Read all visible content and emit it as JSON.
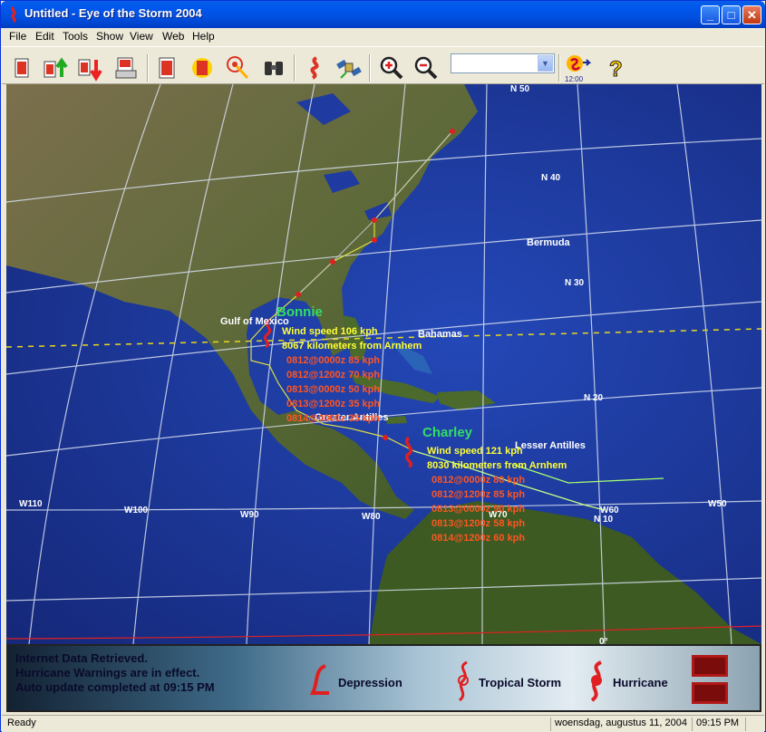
{
  "window": {
    "title": "Untitled - Eye of the Storm 2004",
    "controls": [
      "_",
      "□",
      "✕"
    ]
  },
  "menu": [
    "File",
    "Edit",
    "Tools",
    "Show",
    "View",
    "Web",
    "Help"
  ],
  "toolbar": {
    "icons": [
      "new-storm-icon",
      "import-up-icon",
      "export-down-icon",
      "print-list-icon",
      "storm-edit-icon",
      "storm-track-icon",
      "radar-icon",
      "binoculars-icon",
      "hurricane-symbol-icon",
      "satellite-icon",
      "zoom-in-icon",
      "zoom-out-icon",
      "animation-icon",
      "help-icon"
    ],
    "dropdown_value": "",
    "animation_time": "12:00"
  },
  "map": {
    "lat_labels": [
      "N 50",
      "N 40",
      "N 30",
      "N 20",
      "N 10",
      "0°"
    ],
    "lon_labels": [
      "W110",
      "W100",
      "W90",
      "W80",
      "W70",
      "W60",
      "W50"
    ],
    "places": [
      "Bermuda",
      "Gulf of Mexico",
      "Bahamas",
      "Greater Antilles",
      "Lesser Antilles"
    ],
    "storms": [
      {
        "name": "Bonnie",
        "wind": "Wind speed 106 kph",
        "distance": "8067 kilometers from Arnhem",
        "forecasts": [
          "0812@0000z 85 kph",
          "0812@1200z 70 kph",
          "0813@0000z 50 kph",
          "0813@1200z 35 kph",
          "0814@0000z 35 kph"
        ]
      },
      {
        "name": "Charley",
        "wind": "Wind speed 121 kph",
        "distance": "8030 kilometers from Arnhem",
        "forecasts": [
          "0812@0000z 80 kph",
          "0812@1200z 85 kph",
          "0813@0000z 90 kph",
          "0813@1200z 58 kph",
          "0814@1200z 60 kph"
        ]
      }
    ],
    "colors": {
      "storm_name": "#33dd66",
      "wind": "#ffff33",
      "forecast": "#ff5522",
      "track": "#dddd44",
      "ocean": "#1c3aa0"
    }
  },
  "legend": {
    "messages": [
      "Internet Data Retrieved.",
      "Hurricane Warnings are in effect.",
      "Auto update completed at 09:15  PM"
    ],
    "depression": "Depression",
    "tropical_storm": "Tropical Storm",
    "hurricane": "Hurricane"
  },
  "status": {
    "text": "Ready",
    "date": "woensdag, augustus 11, 2004",
    "time": "09:15  PM"
  }
}
